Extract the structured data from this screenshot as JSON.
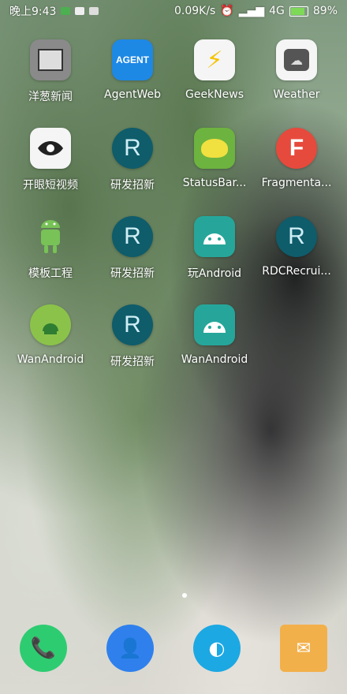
{
  "status_bar": {
    "time": "晚上9:43",
    "speed": "0.09K/s",
    "network": "4G",
    "battery": "89%"
  },
  "apps": [
    [
      {
        "label": "洋葱新闻",
        "icon": "onion-news-icon",
        "color": "#8a8a8a"
      },
      {
        "label": "AgentWeb",
        "icon": "agentweb-icon",
        "color": "#1e88e5"
      },
      {
        "label": "GeekNews",
        "icon": "geeknews-icon",
        "color": "#f5f5f5"
      },
      {
        "label": "Weather",
        "icon": "weather-icon",
        "color": "#f5f5f5"
      }
    ],
    [
      {
        "label": "开眼短视频",
        "icon": "eye-icon",
        "color": "#f5f5f5"
      },
      {
        "label": "研发招新",
        "icon": "r-logo-icon",
        "color": "#0f5c6b"
      },
      {
        "label": "StatusBar...",
        "icon": "chameleon-icon",
        "color": "#6db33f"
      },
      {
        "label": "Fragmenta...",
        "icon": "f-logo-icon",
        "color": "#e64a3c"
      }
    ],
    [
      {
        "label": "模板工程",
        "icon": "android-robot-icon",
        "color": "#78c257"
      },
      {
        "label": "研发招新",
        "icon": "r-logo-icon",
        "color": "#0f5c6b"
      },
      {
        "label": "玩Android",
        "icon": "android-grid-icon",
        "color": "#26a69a"
      },
      {
        "label": "RDCRecrui...",
        "icon": "r-logo-icon",
        "color": "#0f5c6b"
      }
    ],
    [
      {
        "label": "WanAndroid",
        "icon": "android-circle-icon",
        "color": "#8bc34a"
      },
      {
        "label": "研发招新",
        "icon": "r-logo-icon",
        "color": "#0f5c6b"
      },
      {
        "label": "WanAndroid",
        "icon": "android-grid-icon",
        "color": "#26a69a"
      }
    ]
  ],
  "dock": [
    {
      "icon": "phone-icon",
      "color": "#2ecc71"
    },
    {
      "icon": "contacts-icon",
      "color": "#2f80ed"
    },
    {
      "icon": "browser-icon",
      "color": "#1ca8e3"
    },
    {
      "icon": "messages-icon",
      "color": "#f2b04a"
    }
  ],
  "page_indicator": {
    "pages": 1,
    "current": 1
  }
}
